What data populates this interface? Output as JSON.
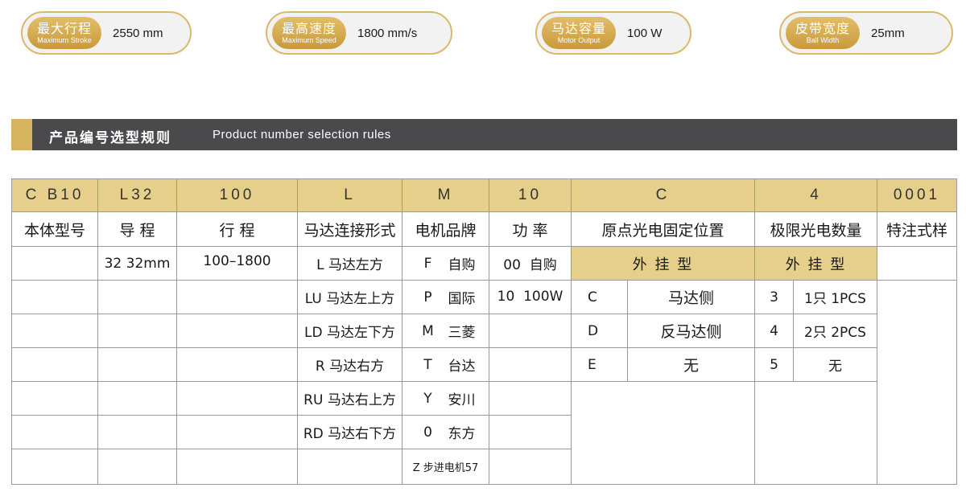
{
  "specs": [
    {
      "zh": "最大行程",
      "en": "Maximum Stroke",
      "value": "2550 mm"
    },
    {
      "zh": "最高速度",
      "en": "Maximum Speed",
      "value": "1800 mm/s"
    },
    {
      "zh": "马达容量",
      "en": "Motor Output",
      "value": "100 W"
    },
    {
      "zh": "皮带宽度",
      "en": "Ball Width",
      "value": "25mm"
    }
  ],
  "section": {
    "title_zh": "产品编号选型规则",
    "title_en": "Product number selection rules"
  },
  "codes": [
    "C  B10",
    "L32",
    "100",
    "L",
    "M",
    "10",
    "C",
    "4",
    "0001"
  ],
  "headers": [
    "本体型号",
    "导 程",
    "行 程",
    "马达连接形式",
    "电机品牌",
    "功 率",
    "原点光电固定位置",
    "极限光电数量",
    "特注式样"
  ],
  "lead": "32 32mm",
  "stroke": "100–1800",
  "motor_connection": [
    "L 马达左方",
    "LU 马达左上方",
    "LD 马达左下方",
    "R 马达右方",
    "RU 马达右上方",
    "RD 马达右下方"
  ],
  "motor_brand": [
    {
      "code": "F",
      "name": "自购"
    },
    {
      "code": "P",
      "name": "国际"
    },
    {
      "code": "M",
      "name": "三菱"
    },
    {
      "code": "T",
      "name": "台达"
    },
    {
      "code": "Y",
      "name": "安川"
    },
    {
      "code": "0",
      "name": "东方"
    }
  ],
  "motor_brand_extra": "Z 步进电机57",
  "power": [
    "00  自购",
    "10  100W"
  ],
  "origin_header": "外 挂 型",
  "origin_rows": [
    {
      "code": "C",
      "name": "马达侧"
    },
    {
      "code": "D",
      "name": "反马达侧"
    },
    {
      "code": "E",
      "name": "无"
    }
  ],
  "limit_header": "外 挂 型",
  "limit_rows": [
    {
      "code": "3",
      "name": "1只 1PCS"
    },
    {
      "code": "4",
      "name": "2只 2PCS"
    },
    {
      "code": "5",
      "name": "无"
    }
  ]
}
